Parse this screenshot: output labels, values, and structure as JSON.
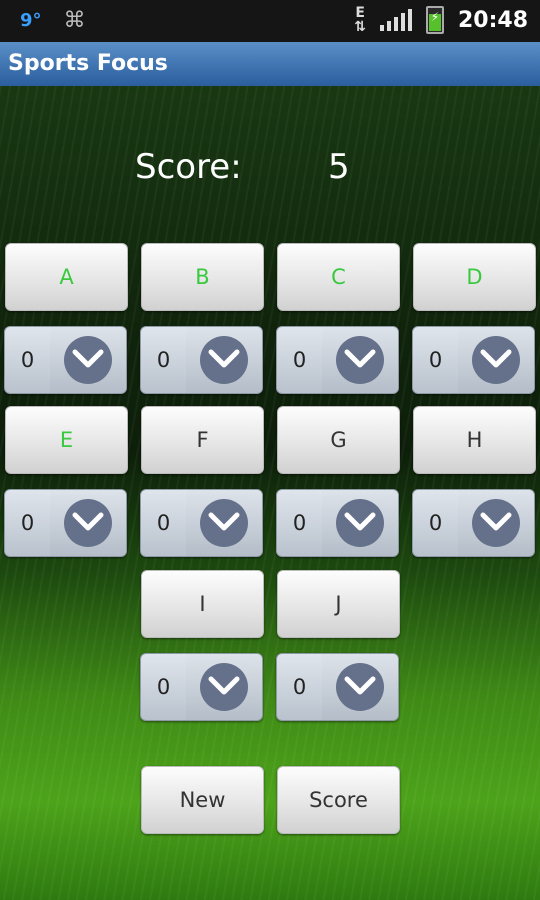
{
  "status": {
    "temperature": "9°",
    "network": "E",
    "time": "20:48"
  },
  "app": {
    "title": "Sports Focus"
  },
  "score": {
    "label": "Score:",
    "value": "5"
  },
  "categories": [
    {
      "label": "A",
      "active": true,
      "count": "0"
    },
    {
      "label": "B",
      "active": true,
      "count": "0"
    },
    {
      "label": "C",
      "active": true,
      "count": "0"
    },
    {
      "label": "D",
      "active": true,
      "count": "0"
    },
    {
      "label": "E",
      "active": true,
      "count": "0"
    },
    {
      "label": "F",
      "active": false,
      "count": "0"
    },
    {
      "label": "G",
      "active": false,
      "count": "0"
    },
    {
      "label": "H",
      "active": false,
      "count": "0"
    },
    {
      "label": "I",
      "active": false,
      "count": "0"
    },
    {
      "label": "J",
      "active": false,
      "count": "0"
    }
  ],
  "actions": {
    "new_label": "New",
    "score_label": "Score"
  },
  "colors": {
    "active_label": "#39c93e",
    "titlebar": "#3a73b5"
  },
  "icons": {
    "usb": "usb-icon",
    "signal": "signal-bars-icon",
    "battery": "battery-charging-icon",
    "dropdown": "chevron-down-icon"
  }
}
